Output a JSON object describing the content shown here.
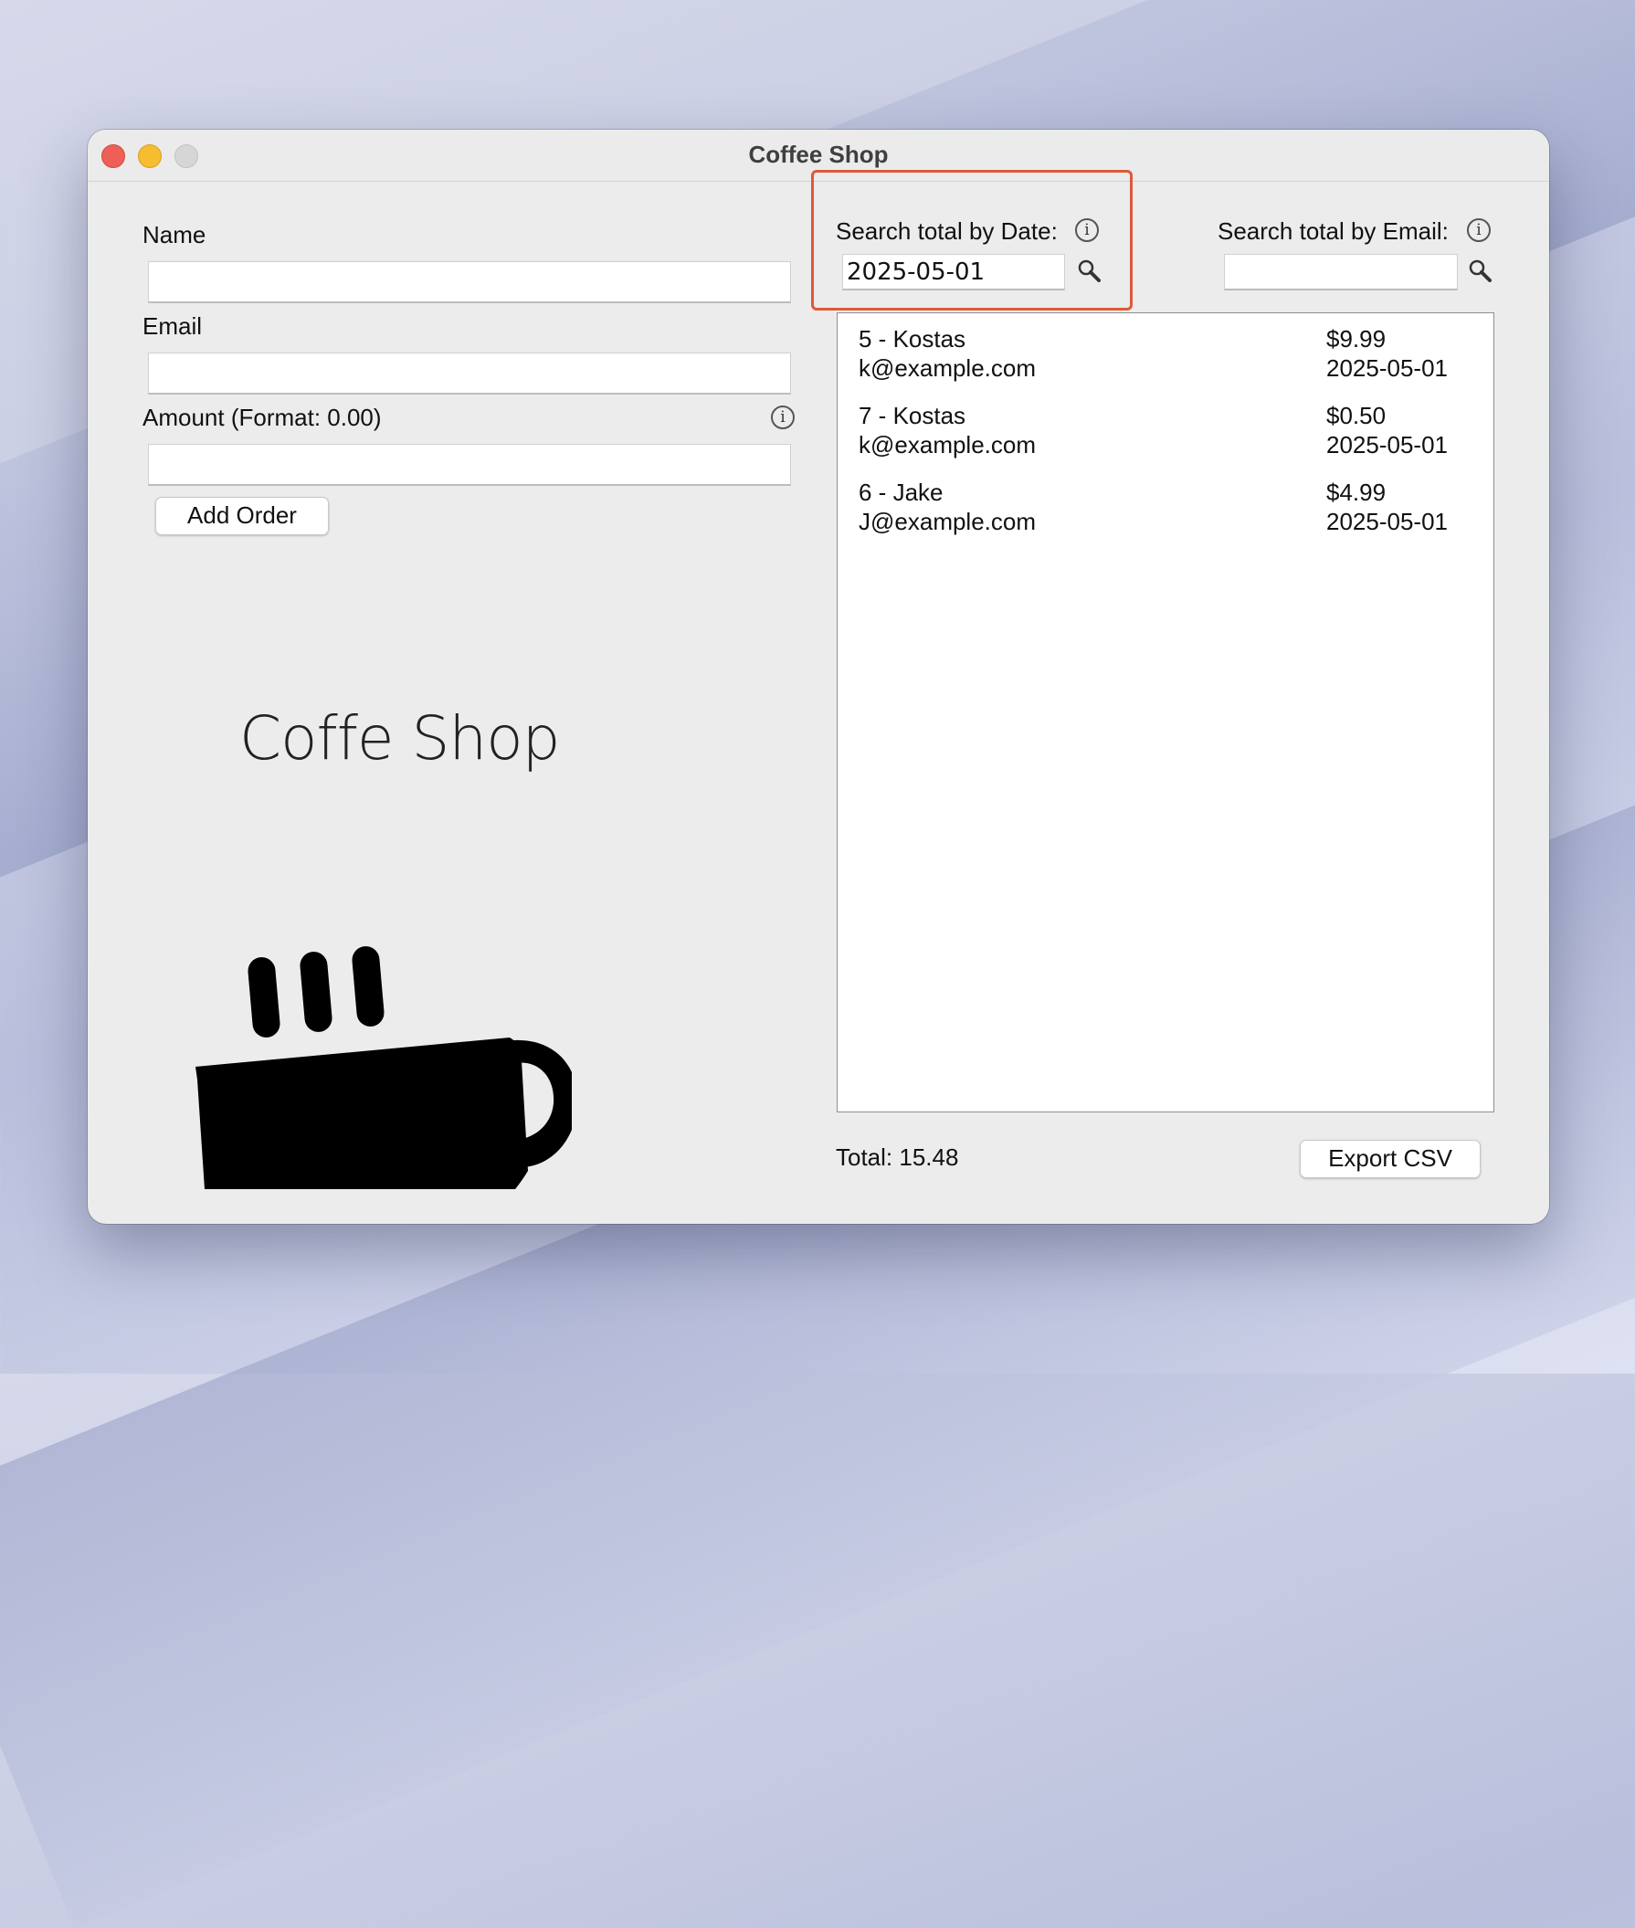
{
  "window": {
    "title": "Coffee Shop"
  },
  "form": {
    "name_label": "Name",
    "name_value": "",
    "email_label": "Email",
    "email_value": "",
    "amount_label": "Amount (Format: 0.00)",
    "amount_value": "",
    "add_button": "Add Order"
  },
  "search": {
    "date_label": "Search total by Date:",
    "date_value": "2025-05-01",
    "email_label": "Search total by Email:",
    "email_value": ""
  },
  "orders": [
    {
      "id_name": "5 - Kostas",
      "email": "k@example.com",
      "amount": "$9.99",
      "date": "2025-05-01"
    },
    {
      "id_name": "7 - Kostas",
      "email": "k@example.com",
      "amount": "$0.50",
      "date": "2025-05-01"
    },
    {
      "id_name": "6 - Jake",
      "email": "J@example.com",
      "amount": "$4.99",
      "date": "2025-05-01"
    }
  ],
  "footer": {
    "total": "Total: 15.48",
    "export_button": "Export CSV"
  },
  "logo": {
    "text": "Coffe Shop"
  },
  "icons": {
    "info": "info-icon",
    "search": "search-icon",
    "cup": "coffee-cup-icon"
  },
  "colors": {
    "highlight": "#dd5a3a",
    "close": "#ee5f57",
    "minimize": "#f5bd2f"
  }
}
